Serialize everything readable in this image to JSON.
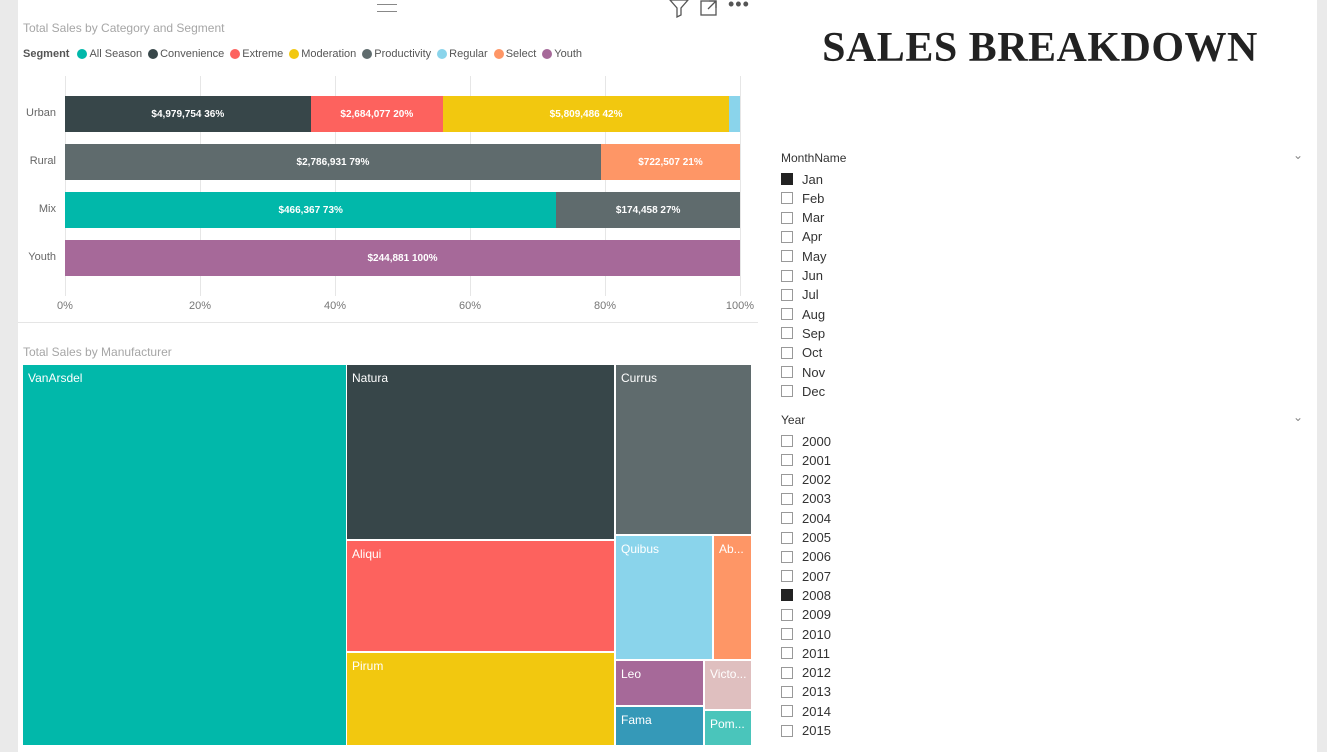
{
  "bar_visual": {
    "title": "Total Sales by Category and Segment",
    "legend_title": "Segment",
    "legend": [
      {
        "label": "All Season",
        "color": "#01b8aa"
      },
      {
        "label": "Convenience",
        "color": "#374649"
      },
      {
        "label": "Extreme",
        "color": "#fd625e"
      },
      {
        "label": "Moderation",
        "color": "#f2c80f"
      },
      {
        "label": "Productivity",
        "color": "#5f6b6d"
      },
      {
        "label": "Regular",
        "color": "#8ad4eb"
      },
      {
        "label": "Select",
        "color": "#fe9666"
      },
      {
        "label": "Youth",
        "color": "#a66999"
      }
    ],
    "categories": [
      "Urban",
      "Rural",
      "Mix",
      "Youth"
    ],
    "ticks": [
      "0%",
      "20%",
      "40%",
      "60%",
      "80%",
      "100%"
    ],
    "bars": [
      {
        "segments": [
          {
            "series": "Convenience",
            "pct": 36.4,
            "label": "$4,979,754  36%"
          },
          {
            "series": "Extreme",
            "pct": 19.6,
            "label": "$2,684,077  20%"
          },
          {
            "series": "Moderation",
            "pct": 42.4,
            "label": "$5,809,486  42%"
          },
          {
            "series": "Regular",
            "pct": 1.6,
            "label": ""
          }
        ]
      },
      {
        "segments": [
          {
            "series": "Productivity",
            "pct": 79.4,
            "label": "$2,786,931  79%"
          },
          {
            "series": "Select",
            "pct": 20.6,
            "label": "$722,507  21%"
          }
        ]
      },
      {
        "segments": [
          {
            "series": "All Season",
            "pct": 72.8,
            "label": "$466,367  73%"
          },
          {
            "series": "Productivity",
            "pct": 27.2,
            "label": "$174,458  27%"
          }
        ]
      },
      {
        "segments": [
          {
            "series": "Youth",
            "pct": 100,
            "label": "$244,881  100%"
          }
        ]
      }
    ]
  },
  "treemap": {
    "title": "Total Sales by Manufacturer",
    "cells": [
      {
        "name": "VanArsdel",
        "color": "#01b8aa"
      },
      {
        "name": "Natura",
        "color": "#374649"
      },
      {
        "name": "Aliqui",
        "color": "#fd625e"
      },
      {
        "name": "Pirum",
        "color": "#f2c80f"
      },
      {
        "name": "Currus",
        "color": "#5f6b6d"
      },
      {
        "name": "Quibus",
        "color": "#8ad4eb"
      },
      {
        "name": "Ab...",
        "color": "#fe9666"
      },
      {
        "name": "Leo",
        "color": "#a66999"
      },
      {
        "name": "Victo...",
        "color": "#dfbfbf"
      },
      {
        "name": "Fama",
        "color": "#3599b8"
      },
      {
        "name": "Pom...",
        "color": "#4ac5bb"
      }
    ]
  },
  "report_title": "SALES BREAKDOWN",
  "month_slicer": {
    "header": "MonthName",
    "items": [
      {
        "label": "Jan",
        "checked": true
      },
      {
        "label": "Feb",
        "checked": false
      },
      {
        "label": "Mar",
        "checked": false
      },
      {
        "label": "Apr",
        "checked": false
      },
      {
        "label": "May",
        "checked": false
      },
      {
        "label": "Jun",
        "checked": false
      },
      {
        "label": "Jul",
        "checked": false
      },
      {
        "label": "Aug",
        "checked": false
      },
      {
        "label": "Sep",
        "checked": false
      },
      {
        "label": "Oct",
        "checked": false
      },
      {
        "label": "Nov",
        "checked": false
      },
      {
        "label": "Dec",
        "checked": false
      }
    ]
  },
  "year_slicer": {
    "header": "Year",
    "items": [
      {
        "label": "2000",
        "checked": false
      },
      {
        "label": "2001",
        "checked": false
      },
      {
        "label": "2002",
        "checked": false
      },
      {
        "label": "2003",
        "checked": false
      },
      {
        "label": "2004",
        "checked": false
      },
      {
        "label": "2005",
        "checked": false
      },
      {
        "label": "2006",
        "checked": false
      },
      {
        "label": "2007",
        "checked": false
      },
      {
        "label": "2008",
        "checked": true
      },
      {
        "label": "2009",
        "checked": false
      },
      {
        "label": "2010",
        "checked": false
      },
      {
        "label": "2011",
        "checked": false
      },
      {
        "label": "2012",
        "checked": false
      },
      {
        "label": "2013",
        "checked": false
      },
      {
        "label": "2014",
        "checked": false
      },
      {
        "label": "2015",
        "checked": false
      }
    ]
  },
  "chart_data": {
    "type": "bar",
    "title": "Total Sales by Category and Segment",
    "orientation": "horizontal-100%-stacked",
    "categories": [
      "Urban",
      "Rural",
      "Mix",
      "Youth"
    ],
    "xlim": [
      0,
      100
    ],
    "legend_position": "top-left",
    "series": [
      {
        "name": "All Season",
        "values": [
          0,
          0,
          466367,
          0
        ]
      },
      {
        "name": "Convenience",
        "values": [
          4979754,
          0,
          0,
          0
        ]
      },
      {
        "name": "Extreme",
        "values": [
          2684077,
          0,
          0,
          0
        ]
      },
      {
        "name": "Moderation",
        "values": [
          5809486,
          0,
          0,
          0
        ]
      },
      {
        "name": "Productivity",
        "values": [
          0,
          2786931,
          174458,
          0
        ]
      },
      {
        "name": "Regular",
        "values": [
          0,
          0,
          0,
          0
        ]
      },
      {
        "name": "Select",
        "values": [
          0,
          722507,
          0,
          0
        ]
      },
      {
        "name": "Youth",
        "values": [
          0,
          0,
          0,
          244881
        ]
      }
    ]
  }
}
